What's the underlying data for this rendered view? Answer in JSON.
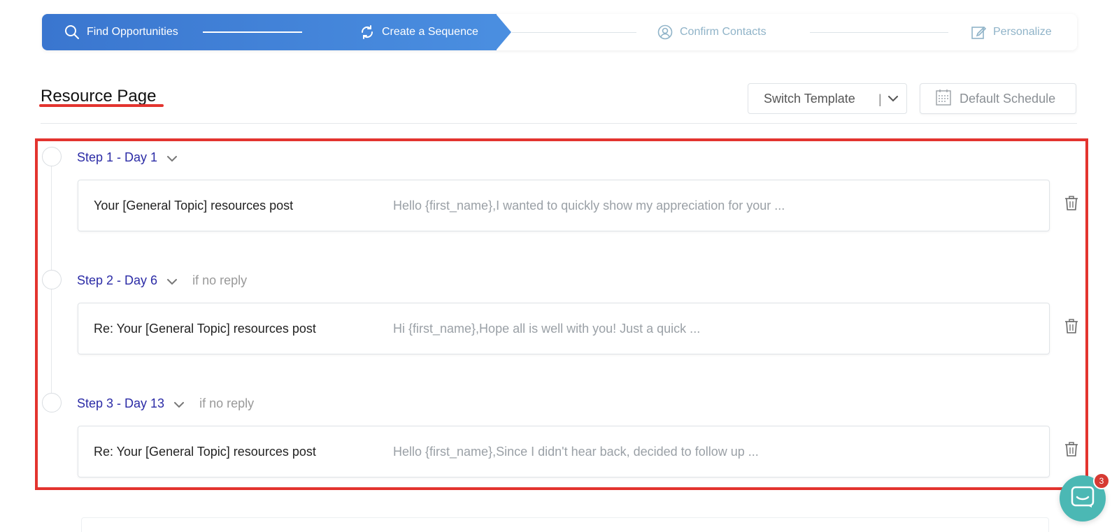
{
  "stepper": {
    "steps": [
      {
        "label": "Find Opportunities",
        "icon": "search-icon",
        "state": "active"
      },
      {
        "label": "Create a Sequence",
        "icon": "refresh-icon",
        "state": "active"
      },
      {
        "label": "Confirm Contacts",
        "icon": "user-circle-icon",
        "state": "inactive"
      },
      {
        "label": "Personalize",
        "icon": "edit-icon",
        "state": "inactive"
      }
    ]
  },
  "header": {
    "title": "Resource Page",
    "switch_template_label": "Switch Template",
    "separator": "|",
    "default_schedule_label": "Default Schedule"
  },
  "sequence": {
    "steps": [
      {
        "label": "Step 1 - Day 1",
        "condition": "",
        "subject": "Your [General Topic] resources post",
        "preview": "Hello {first_name},I wanted to quickly show my appreciation for your ..."
      },
      {
        "label": "Step 2 - Day 6",
        "condition": "if no reply",
        "subject": "Re: Your [General Topic] resources post",
        "preview": "Hi {first_name},Hope all is well with you! Just a quick ..."
      },
      {
        "label": "Step 3 - Day 13",
        "condition": "if no reply",
        "subject": "Re: Your [General Topic] resources post",
        "preview": "Hello {first_name},Since I didn't hear back, decided to follow up ..."
      }
    ]
  },
  "chat": {
    "badge_count": "3"
  },
  "colors": {
    "accent_blue": "#3a76cf",
    "highlight_red": "#e3342f",
    "step_label": "#2b2ba6",
    "chat_teal": "#4bb8b4"
  }
}
